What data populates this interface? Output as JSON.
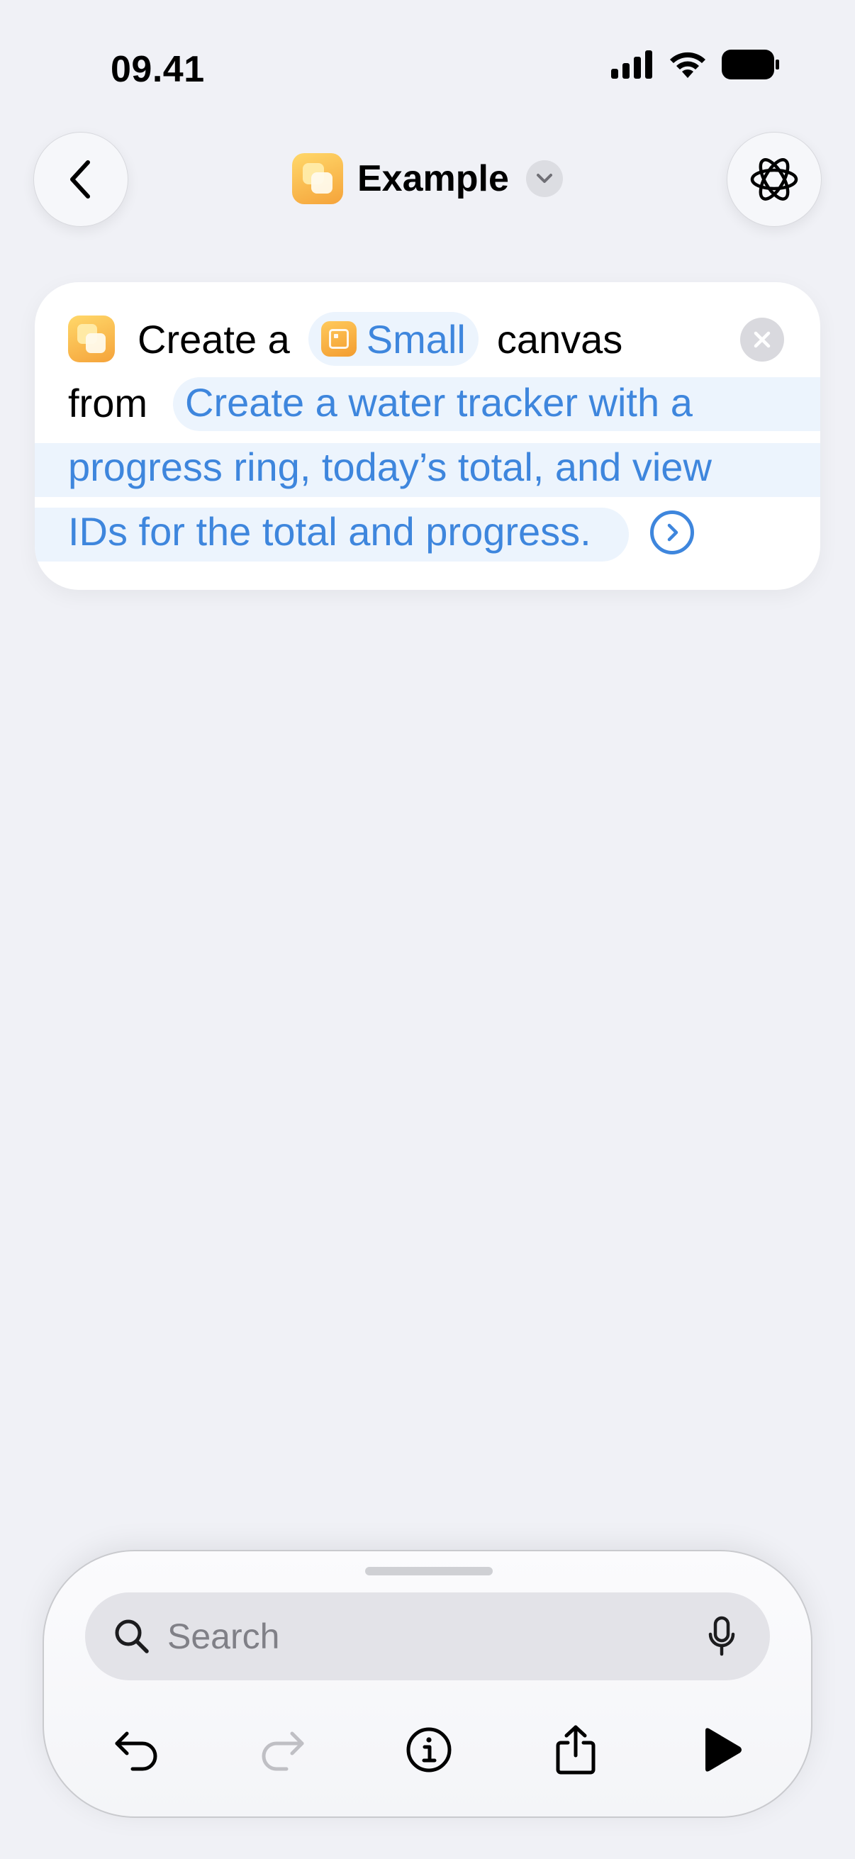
{
  "status_bar": {
    "time": "09.41"
  },
  "nav": {
    "title": "Example",
    "back_icon": "chevron-left-icon",
    "menu_icon": "chevron-down-icon",
    "ai_icon": "apple-intelligence-icon"
  },
  "action_card": {
    "prefix": "Create a",
    "size_label": "Small",
    "canvas_word": "canvas",
    "from_word": "from",
    "prompt_lines": [
      "Create a water tracker with a",
      "progress ring, today’s total, and view",
      "IDs for the total and progress."
    ],
    "accent_color": "#3e86dd"
  },
  "bottom_sheet": {
    "search": {
      "placeholder": "Search"
    },
    "toolbar": [
      "undo-icon",
      "redo-icon",
      "info-icon",
      "share-icon",
      "play-icon"
    ]
  }
}
